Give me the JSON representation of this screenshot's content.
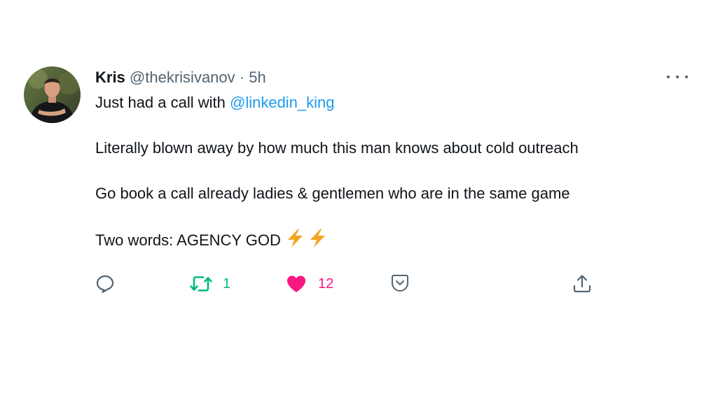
{
  "tweet": {
    "author_name": "Kris",
    "handle": "@thekrisivanov",
    "separator": "·",
    "time": "5h",
    "lines": {
      "line1_prefix": "Just had a call with ",
      "line1_mention": "@linkedin_king",
      "line2": "Literally blown away by how much this man knows about cold outreach",
      "line3": "Go book a call already ladies & gentlemen who are in the same game",
      "line4": "Two words: AGENCY GOD"
    },
    "emoji": "lightning-bolt-x2"
  },
  "actions": {
    "reply_icon": "reply-icon",
    "retweet_count": "1",
    "like_count": "12",
    "bookmark_icon": "bookmark-icon",
    "share_icon": "share-icon"
  },
  "colors": {
    "text": "#0f1419",
    "secondary": "#536471",
    "mention": "#1d9bf0",
    "retweet": "#00ba7c",
    "like": "#f91880",
    "bolt": "#f4a523"
  }
}
